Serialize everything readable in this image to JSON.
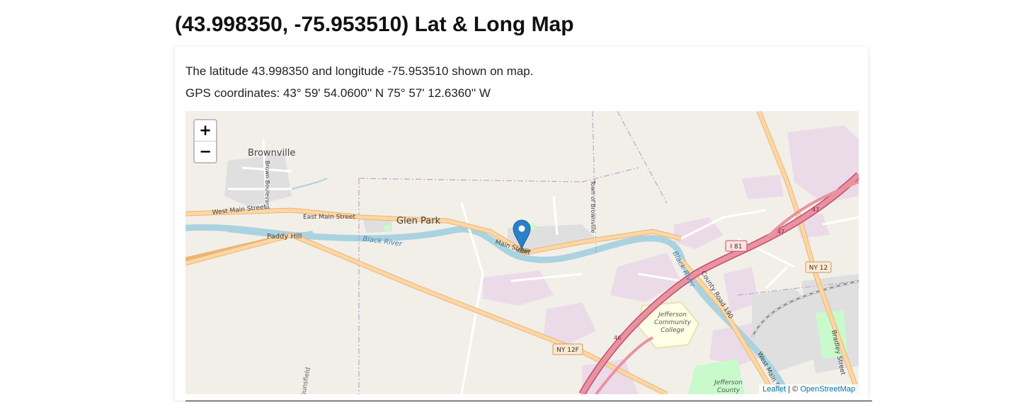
{
  "page": {
    "title": "(43.998350, -75.953510) Lat & Long Map"
  },
  "info": {
    "description": "The latitude 43.998350 and longitude -75.953510 shown on map.",
    "gps": "GPS coordinates: 43° 59' 54.0600'' N 75° 57' 12.6360'' W"
  },
  "map": {
    "zoom_in": "+",
    "zoom_out": "−",
    "marker_icon": "map-pin-icon",
    "labels": {
      "brownville": "Brownville",
      "glen_park": "Glen Park",
      "paddy_hill": "Paddy Hill",
      "black_river": "Black River",
      "black_river_2": "Black River",
      "west_main_street": "West Main Street",
      "east_main_street": "East Main Street",
      "main_street": "Main Street",
      "brown_boulevard": "Brown Boulevard",
      "town_of_brownville": "Town of Brownville",
      "county_road_190": "County Road 190",
      "west_main_street_2": "West Main Street",
      "bradley_street": "Bradley Street",
      "jcc": "Jefferson Community College",
      "jcc_1": "Jefferson",
      "jcc_2": "Community",
      "jcc_3": "College",
      "jefferson_county_1": "Jefferson",
      "jefferson_county_2": "County",
      "ounsfield": "ounsfield",
      "i81": "I 81",
      "ny12": "NY 12",
      "ny12f": "NY 12F",
      "exit47a": "47",
      "exit47b": "47",
      "exit46": "46"
    },
    "attribution": {
      "leaflet": "Leaflet",
      "separator": " | © ",
      "osm": "OpenStreetMap"
    },
    "colors": {
      "land": "#f2efe9",
      "water": "#aad3df",
      "major_road": "#fcd6a4",
      "motorway": "#e892a2",
      "residential": "#e0dfdf",
      "industrial": "#ebdbe8",
      "park": "#c8facc",
      "college": "#ffffe5",
      "marker": "#2a81cb"
    }
  }
}
